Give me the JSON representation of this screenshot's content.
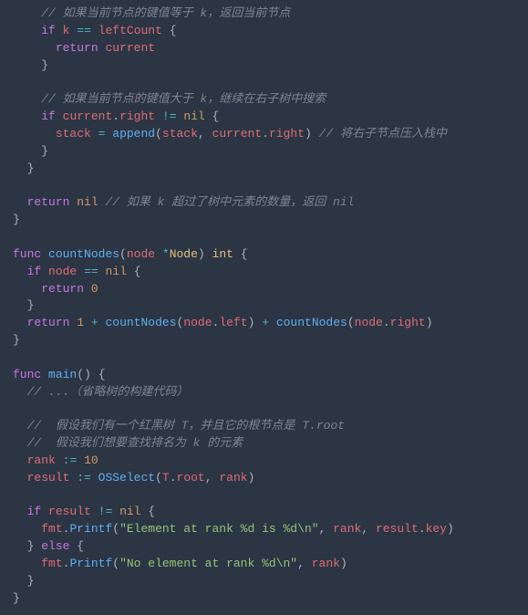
{
  "comments": {
    "c1": "// 如果当前节点的键值等于 k，返回当前节点",
    "c2": "// 如果当前节点的键值大于 k，继续在右子树中搜索",
    "c3": "// 将右子节点压入栈中",
    "c4": "// 如果 k 超过了树中元素的数量，返回 nil",
    "c5": "// ...（省略树的构建代码）",
    "c6": "//  假设我们有一个红黑树 T，并且它的根节点是 T.root",
    "c7": "//  假设我们想要查找排名为 k 的元素"
  },
  "tok": {
    "if": "if",
    "return": "return",
    "nil": "nil",
    "func": "func",
    "int": "int",
    "else": "else",
    "append": "append",
    "countNodes": "countNodes",
    "main": "main",
    "OSSelect": "OSSelect",
    "Printf": "Printf",
    "k": "k",
    "leftCount": "leftCount",
    "current": "current",
    "right": "right",
    "left": "left",
    "stack": "stack",
    "node": "node",
    "Node": "Node",
    "rank": "rank",
    "result": "result",
    "T": "T",
    "root": "root",
    "fmt": "fmt",
    "key": "key",
    "eq": "==",
    "neq": "!=",
    "assign": ":=",
    "plus": "+",
    "star": "*",
    "lbrace": "{",
    "rbrace": "}",
    "lparen": "(",
    "rparen": ")",
    "comma": ", ",
    "dot": ".",
    "eqsign": "=",
    "n0": "0",
    "n1": "1",
    "n10": "10",
    "s1": "\"Element at rank %d is %d\\n\"",
    "s2": "\"No element at rank %d\\n\""
  }
}
